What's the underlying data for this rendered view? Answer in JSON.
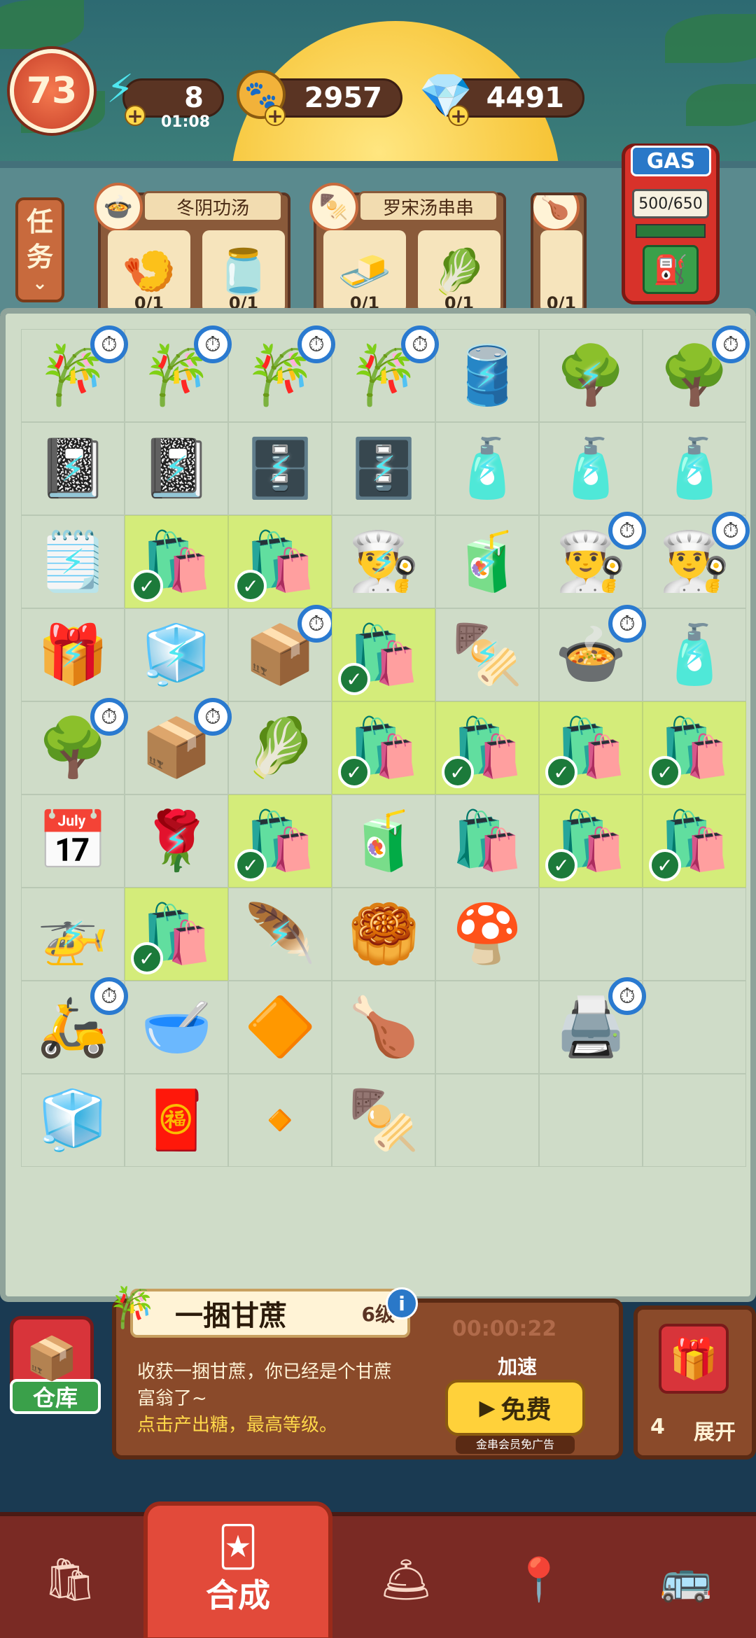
{
  "hud": {
    "level": "73",
    "energy": "8",
    "energy_timer": "01:08",
    "coins": "2957",
    "gems": "4491"
  },
  "tasks_label": [
    "任",
    "务"
  ],
  "orders": [
    {
      "title": "冬阴功汤",
      "icon": "🍲",
      "items": [
        {
          "icon": "🍤",
          "count": "0/1"
        },
        {
          "icon": "🫙",
          "count": "0/1"
        }
      ]
    },
    {
      "title": "罗宋汤串串",
      "icon": "🍢",
      "items": [
        {
          "icon": "🧈",
          "count": "0/1"
        },
        {
          "icon": "🥬",
          "count": "0/1"
        }
      ]
    },
    {
      "title": "",
      "icon": "🍗",
      "items": [
        {
          "icon": "",
          "count": "0/1"
        }
      ]
    }
  ],
  "gas": {
    "label": "GAS",
    "value": "500/650"
  },
  "board": [
    [
      {
        "i": "🎋",
        "t": 1
      },
      {
        "i": "🎋",
        "t": 1
      },
      {
        "i": "🎋",
        "t": 1
      },
      {
        "i": "🎋",
        "t": 1
      },
      {
        "i": "🛢️",
        "b": 1
      },
      {
        "i": "🌳",
        "b": 1
      },
      {
        "i": "🌳",
        "t": 1
      }
    ],
    [
      {
        "i": "📓",
        "b": 1
      },
      {
        "i": "📓",
        "b": 1
      },
      {
        "i": "🗄️",
        "b": 1
      },
      {
        "i": "🗄️",
        "b": 1
      },
      {
        "i": "🧴",
        "b": 1
      },
      {
        "i": "🧴",
        "b": 1
      },
      {
        "i": "🧴",
        "b": 1
      }
    ],
    [
      {
        "i": "🗒️",
        "b": 1
      },
      {
        "i": "🛍️",
        "c": 1
      },
      {
        "i": "🛍️",
        "c": 1
      },
      {
        "i": "👨‍🍳",
        "b": 1
      },
      {
        "i": "🧃",
        "b": 1
      },
      {
        "i": "👨‍🍳",
        "t": 1
      },
      {
        "i": "👨‍🍳",
        "t": 1
      }
    ],
    [
      {
        "i": "🎁",
        "b": 1
      },
      {
        "i": "🧊",
        "b": 1
      },
      {
        "i": "📦",
        "t": 1
      },
      {
        "i": "🛍️",
        "c": 1
      },
      {
        "i": "🍢",
        "b": 1
      },
      {
        "i": "🍲",
        "t": 1
      },
      {
        "i": "🧴",
        "b": 1
      }
    ],
    [
      {
        "i": "🌳",
        "t": 1
      },
      {
        "i": "📦",
        "t": 1
      },
      {
        "i": "🥬"
      },
      {
        "i": "🛍️",
        "c": 1
      },
      {
        "i": "🛍️",
        "c": 1
      },
      {
        "i": "🛍️",
        "c": 1
      },
      {
        "i": "🛍️",
        "c": 1
      }
    ],
    [
      {
        "i": "📅"
      },
      {
        "i": "🌹",
        "b": 1
      },
      {
        "i": "🛍️",
        "c": 1
      },
      {
        "i": "🧃"
      },
      {
        "i": "🛍️"
      },
      {
        "i": "🛍️",
        "c": 1
      },
      {
        "i": "🛍️",
        "c": 1
      }
    ],
    [
      {
        "i": "🚁",
        "b": 1
      },
      {
        "i": "🛍️",
        "c": 1
      },
      {
        "i": "🪶",
        "b": 1
      },
      {
        "i": "🥮"
      },
      {
        "i": "🍄"
      },
      {
        "i": ""
      },
      {
        "i": ""
      }
    ],
    [
      {
        "i": "🛵",
        "t": 1
      },
      {
        "i": "🥣"
      },
      {
        "i": "🔶"
      },
      {
        "i": "🍗"
      },
      {
        "i": ""
      },
      {
        "i": "🖨️",
        "t": 1
      },
      {
        "i": ""
      }
    ],
    [
      {
        "i": "🧊"
      },
      {
        "i": "🧧"
      },
      {
        "i": "🔸"
      },
      {
        "i": "🍢"
      },
      {
        "i": ""
      },
      {
        "i": ""
      },
      {
        "i": ""
      }
    ]
  ],
  "info": {
    "title": "一捆甘蔗",
    "level": "6级",
    "timer": "00:00:22",
    "desc1": "收获一捆甘蔗，你已经是个甘蔗富翁了~",
    "desc2": "点击产出糖，最高等级。",
    "speed_label": "加速",
    "free_label": "免费",
    "vip_note": "金串会员免广告"
  },
  "warehouse_label": "仓库",
  "expand": {
    "count": "4",
    "label": "展开"
  },
  "nav": {
    "merge_label": "合成"
  }
}
